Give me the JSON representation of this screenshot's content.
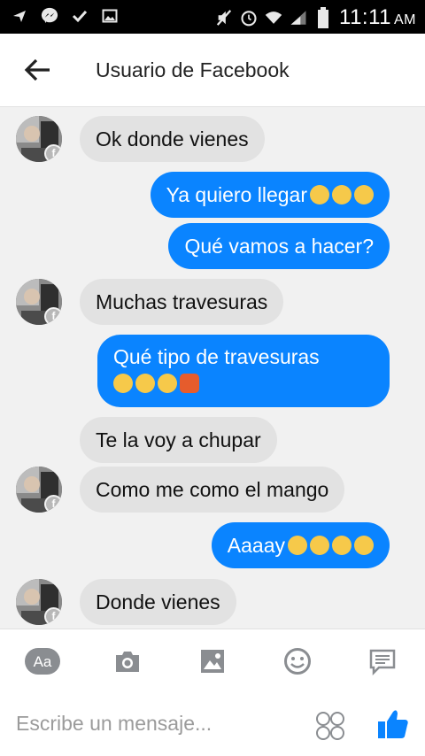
{
  "status_bar": {
    "left_icons": [
      "send-arrow-icon",
      "messenger-icon",
      "check-icon",
      "image-icon"
    ],
    "right_icons": [
      "mute-icon",
      "alarm-icon",
      "wifi-icon",
      "signal-icon",
      "battery-icon"
    ],
    "time": "11:11",
    "ampm": "AM"
  },
  "header": {
    "title": "Usuario de Facebook",
    "back_icon": "arrow-left-icon"
  },
  "messages": [
    {
      "from": "them",
      "text": "Ok donde vienes"
    },
    {
      "from": "me",
      "text": "Ya quiero llegar",
      "emojis": [
        "heart-eyes",
        "heart-eyes",
        "heart-eyes"
      ]
    },
    {
      "from": "me",
      "text": "Qué vamos a hacer?"
    },
    {
      "from": "them",
      "text": "Muchas travesuras"
    },
    {
      "from": "me",
      "text": "Qué tipo de travesuras",
      "emojis": [
        "heart-eyes",
        "heart-eyes",
        "grin",
        "devil"
      ]
    },
    {
      "from": "them",
      "text": "Te la voy a chupar"
    },
    {
      "from": "them",
      "text": "Como me como el mango"
    },
    {
      "from": "me",
      "text": "Aaaay",
      "emojis": [
        "tongue-out",
        "tongue-out",
        "tongue-out",
        "heart-eyes"
      ]
    },
    {
      "from": "them",
      "text": "Donde vienes"
    }
  ],
  "toolbar": {
    "text_button": "Aa",
    "icons": [
      "camera-icon",
      "gallery-icon",
      "smiley-icon",
      "quick-reply-icon"
    ]
  },
  "composer": {
    "placeholder": "Escribe un mensaje...",
    "emoji_icon": "emoji-picker-icon",
    "like_icon": "thumbs-up-icon"
  },
  "colors": {
    "accent": "#0a84ff",
    "incoming_bubble": "#e2e2e2",
    "chat_background": "#f1f1f1"
  }
}
